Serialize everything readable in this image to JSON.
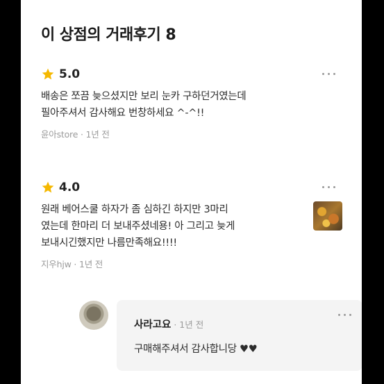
{
  "header": {
    "title": "이 상점의 거래후기 8"
  },
  "reviews": [
    {
      "rating": "5.0",
      "text_lines": [
        "배송은 쪼끔 늦으셨지만 보리 눈카 구하던거였는데",
        "필아주셔서 감사해요 번창하세요 ^-^!!"
      ],
      "meta": "윤아store · 1년 전",
      "icon": "star-icon"
    },
    {
      "rating": "4.0",
      "text_lines": [
        "원래 베어스쿨 하자가 좀 심하긴 하지만 3마리",
        "였는데 한마리 더 보내주셨네용! 아 그리고 늦게",
        "보내시긴했지만 나름만족해요!!!!"
      ],
      "meta": "지우hjw · 1년 전",
      "icon": "star-icon"
    }
  ],
  "reply": {
    "name": "사라고요",
    "time": " · 1년 전",
    "text": "구매해주셔서 감사합니당 ♥♥"
  },
  "colors": {
    "star": "#f5b800",
    "background": "#ffffff",
    "frame": "#000000",
    "reply_bg": "#f4f4f4"
  }
}
